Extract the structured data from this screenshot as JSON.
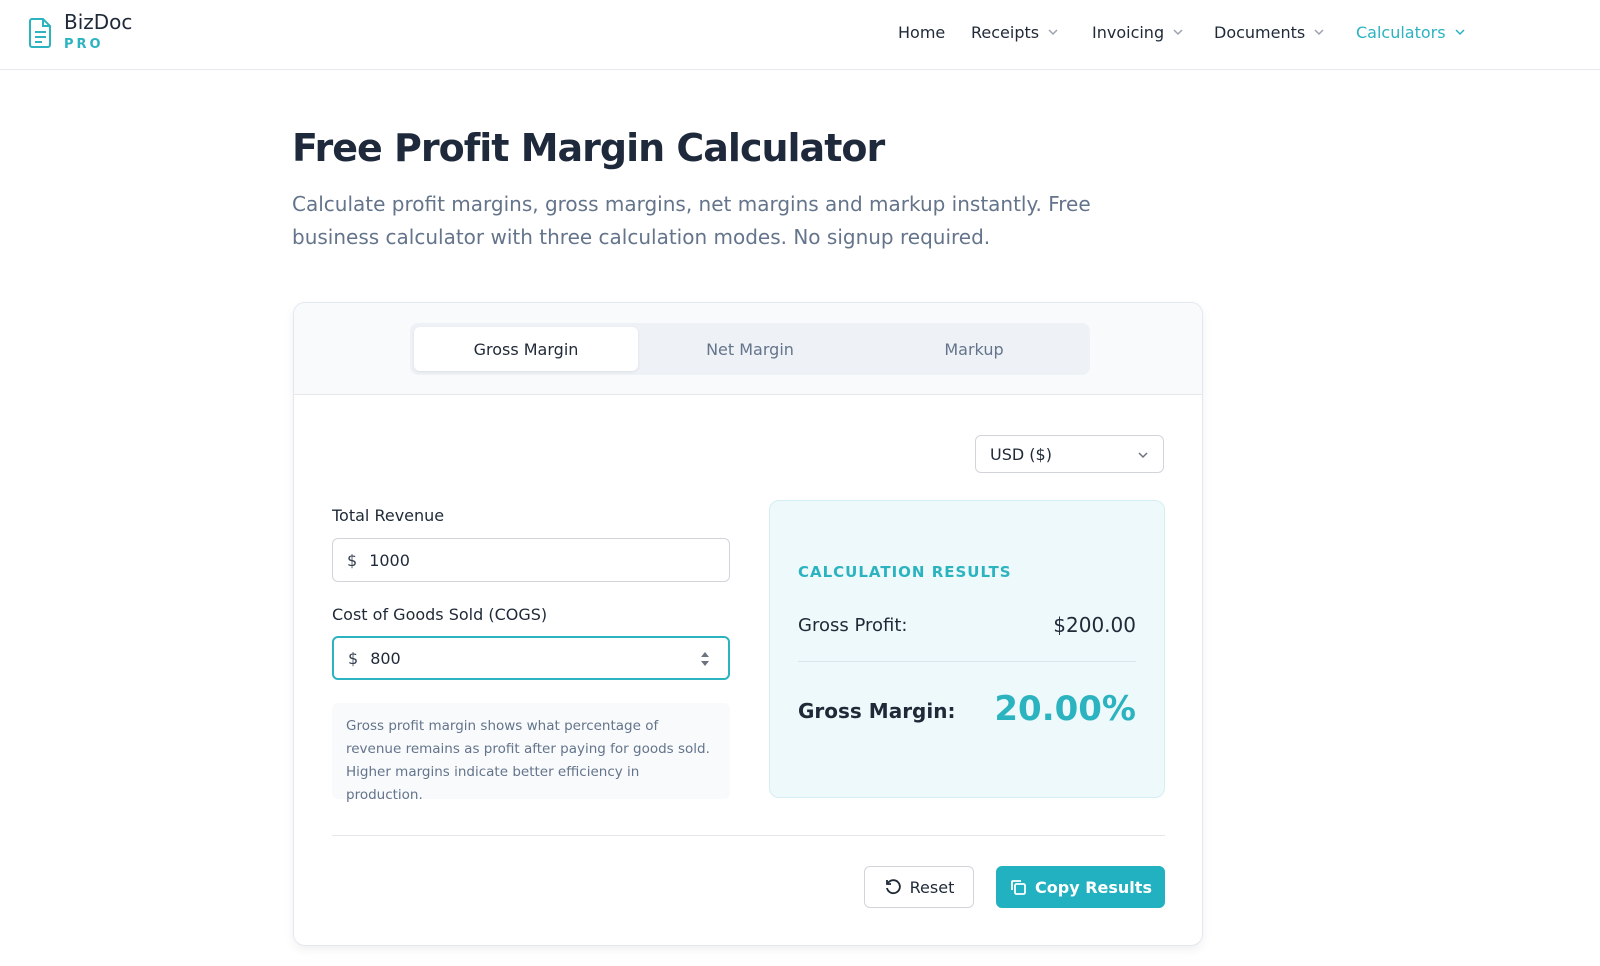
{
  "brand": {
    "name": "BizDoc",
    "tagline": "PRO"
  },
  "nav": {
    "home": "Home",
    "receipts": "Receipts",
    "invoicing": "Invoicing",
    "documents": "Documents",
    "calculators": "Calculators"
  },
  "page": {
    "title": "Free Profit Margin Calculator",
    "description": "Calculate profit margins, gross margins, net margins and markup instantly. Free business calculator with three calculation modes. No signup required."
  },
  "tabs": [
    {
      "label": "Gross Margin",
      "active": true
    },
    {
      "label": "Net Margin",
      "active": false
    },
    {
      "label": "Markup",
      "active": false
    }
  ],
  "currency": {
    "selected": "USD ($)"
  },
  "form": {
    "revenue": {
      "label": "Total Revenue",
      "symbol": "$",
      "value": "1000"
    },
    "cogs": {
      "label": "Cost of Goods Sold (COGS)",
      "symbol": "$",
      "value": "800"
    },
    "hint": "Gross profit margin shows what percentage of revenue remains as profit after paying for goods sold. Higher margins indicate better efficiency in production."
  },
  "results": {
    "title": "CALCULATION RESULTS",
    "gross_profit_label": "Gross Profit:",
    "gross_profit_value": "$200.00",
    "gross_margin_label": "Gross Margin:",
    "gross_margin_value": "20.00%"
  },
  "buttons": {
    "reset": "Reset",
    "copy": "Copy Results"
  },
  "colors": {
    "accent": "#2bb3c0",
    "button": "#22b1c0",
    "heading": "#1e293b"
  }
}
